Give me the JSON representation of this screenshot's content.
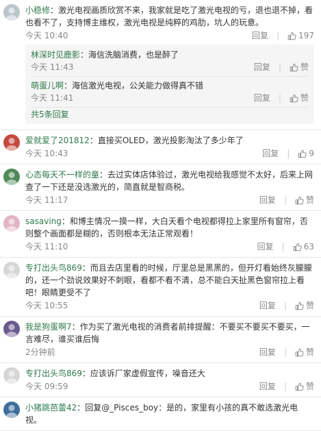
{
  "reply_label": "回复",
  "like_label": "赞",
  "comments": [
    {
      "user": "小稳修",
      "text": "激光电视画质欣赏不来，我家就是吃了激光电视的亏，退也退不掉，看也看不了，支持博主维权，激光电视是纯粹的鸡肋，坑人的玩意。",
      "time": "今天 10:40",
      "likes": "197",
      "avatar_color": "#b9c6cc",
      "replies": [
        {
          "user": "林深时见鹿影",
          "text": "海信洗脑消费，也是醉了",
          "time": "今天 11:43"
        },
        {
          "user": "萌蛋儿啊",
          "text": "海信激光电视，公关能力做得真不错",
          "time": "今天 11:41"
        }
      ],
      "more_replies": "共5条回复"
    },
    {
      "user": "爱就爱了201812",
      "text": "直接买OLED，激光投影淘汰了多少年了",
      "time": "今天 10:43",
      "likes": "9",
      "avatar_color": "#c44a3e"
    },
    {
      "user": "心态每天不一样的童",
      "text": "去过实体店体验过，激光电视给我感觉不太好，后来上网查了一下还是没选激光的，简直就是智商税。",
      "time": "今天 11:17",
      "likes": "",
      "avatar_color": "#4e8a5a"
    },
    {
      "user": "sasaving",
      "text": "和博主情况一摸一样，大白天看个电视都得拉上家里所有窗帘，否则整个画面都是糊的，否则根本无法正常观看！",
      "time": "今天 11:10",
      "likes": "63",
      "avatar_color": "#e2b4c4"
    },
    {
      "user": "专打出头鸟869",
      "text": "而且去店里看的时候，厅里总是黑黑的，但开灯看始终灰朦朦的，还一个劲说效果好不刺眼，看都不看不清，总不能白天扯黑色窗帘拉上看吧！眼睛更受不了",
      "time": "今天 10:55",
      "likes": "",
      "avatar_color": "#d6d6d6"
    },
    {
      "user": "我是狗蛋啊7",
      "text": "作为买了激光电视的消费者前排提醒：不要买不要买不要买，一言难尽，谁买谁后悔",
      "time": "2分钟前",
      "likes": "",
      "avatar_color": "#6a5b8f"
    },
    {
      "user": "专打出头鸟869",
      "text": "应该诉厂家虚假宣传，噪音还大",
      "time": "今天 09:59",
      "likes": "",
      "avatar_color": "#d6d6d6"
    },
    {
      "user": "小猪跳芭蕾42",
      "text": "回复@_Pisces_boy：是的，家里有小孩的真不敢选激光电视。",
      "time": "",
      "likes": "",
      "avatar_color": "#3f6e9c"
    }
  ]
}
